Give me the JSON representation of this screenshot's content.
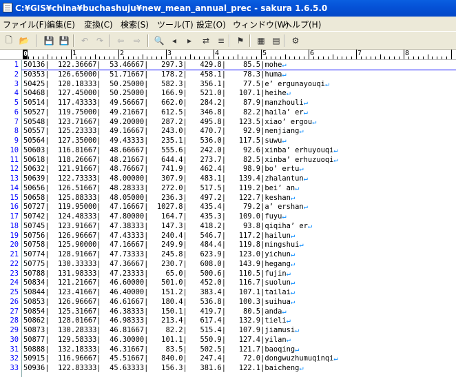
{
  "window": {
    "title": "C:¥GIS¥china¥buchashuju¥new_mean_annual_prec - sakura 1.6.5.0"
  },
  "menu": [
    "ファイル(F)",
    "編集(E)",
    "変換(C)",
    "検索(S)",
    "ツール(T)",
    "設定(O)",
    "ウィンドウ(W)",
    "ヘルプ(H)"
  ],
  "toolbar_icons": [
    "new-file-icon",
    "open-folder-icon",
    "save-disabled-icon",
    "save-icon",
    "undo-icon",
    "redo-icon",
    "jump-back-icon",
    "jump-forward-icon",
    "search-icon",
    "search-prev-icon",
    "search-next-icon",
    "replace-icon",
    "grep-icon",
    "bookmark-icon",
    "outline-icon",
    "fold-icon",
    "settings-icon"
  ],
  "ruler": {
    "marks": [
      "0",
      "1",
      "2",
      "3",
      "4",
      "5",
      "6",
      "7",
      "8"
    ]
  },
  "lines": [
    {
      "n": "1",
      "text": "50136|  122.36667|  53.46667|   297.3|   429.8|    85.5|mohe"
    },
    {
      "n": "2",
      "text": "50353|  126.65000|  51.71667|   178.2|   458.1|    78.3|huma"
    },
    {
      "n": "3",
      "text": "50425|  120.18333|  50.25000|   582.3|   356.1|    77.5|e’ ergunayouqi"
    },
    {
      "n": "4",
      "text": "50468|  127.45000|  50.25000|   166.9|   521.0|   107.1|heihe"
    },
    {
      "n": "5",
      "text": "50514|  117.43333|  49.56667|   662.0|   284.2|    87.9|manzhouli"
    },
    {
      "n": "6",
      "text": "50527|  119.75000|  49.21667|   612.5|   346.8|    82.2|haila’ er"
    },
    {
      "n": "7",
      "text": "50548|  123.71667|  49.20000|   287.2|   495.8|   123.5|xiao’ ergou"
    },
    {
      "n": "8",
      "text": "50557|  125.23333|  49.16667|   243.0|   470.7|    92.9|nenjiang"
    },
    {
      "n": "9",
      "text": "50564|  127.35000|  49.43333|   235.1|   536.0|   117.5|suwu"
    },
    {
      "n": "10",
      "text": "50603|  116.81667|  48.66667|   555.6|   242.0|    92.6|xinba’ erhuyouqi"
    },
    {
      "n": "11",
      "text": "50618|  118.26667|  48.21667|   644.4|   273.7|    82.5|xinba’ erhuzuoqi"
    },
    {
      "n": "12",
      "text": "50632|  121.91667|  48.76667|   741.9|   462.4|    98.9|bo’ ertu"
    },
    {
      "n": "13",
      "text": "50639|  122.73333|  48.00000|   307.9|   483.1|   139.4|zhalantun"
    },
    {
      "n": "14",
      "text": "50656|  126.51667|  48.28333|   272.0|   517.5|   119.2|bei’ an"
    },
    {
      "n": "15",
      "text": "50658|  125.88333|  48.05000|   236.3|   497.2|   122.7|keshan"
    },
    {
      "n": "16",
      "text": "50727|  119.95000|  47.16667|  1027.8|   435.4|    79.2|a’ ershan"
    },
    {
      "n": "17",
      "text": "50742|  124.48333|  47.80000|   164.7|   435.3|   109.0|fuyu"
    },
    {
      "n": "18",
      "text": "50745|  123.91667|  47.38333|   147.3|   418.2|    93.8|qiqiha’ er"
    },
    {
      "n": "19",
      "text": "50756|  126.96667|  47.43333|   240.4|   546.7|   117.2|hailun"
    },
    {
      "n": "20",
      "text": "50758|  125.90000|  47.16667|   249.9|   484.4|   119.8|mingshui"
    },
    {
      "n": "21",
      "text": "50774|  128.91667|  47.73333|   245.8|   623.9|   123.0|yichun"
    },
    {
      "n": "22",
      "text": "50775|  130.33333|  47.36667|   230.7|   608.0|   143.9|hegang"
    },
    {
      "n": "23",
      "text": "50788|  131.98333|  47.23333|    65.0|   500.6|   110.5|fujin"
    },
    {
      "n": "24",
      "text": "50834|  121.21667|  46.60000|   501.0|   452.0|   116.7|suolun"
    },
    {
      "n": "25",
      "text": "50844|  123.41667|  46.40000|   151.2|   383.4|   107.1|tailai"
    },
    {
      "n": "26",
      "text": "50853|  126.96667|  46.61667|   180.4|   536.8|   100.3|suihua"
    },
    {
      "n": "27",
      "text": "50854|  125.31667|  46.38333|   150.1|   419.7|    80.5|anda"
    },
    {
      "n": "28",
      "text": "50862|  128.01667|  46.98333|   213.4|   617.4|   132.9|tieli"
    },
    {
      "n": "29",
      "text": "50873|  130.28333|  46.81667|    82.2|   515.4|   107.9|jiamusi"
    },
    {
      "n": "30",
      "text": "50877|  129.58333|  46.30000|   101.1|   550.9|   127.4|yilan"
    },
    {
      "n": "31",
      "text": "50888|  132.18333|  46.31667|    83.5|   502.5|   121.7|baoqing"
    },
    {
      "n": "32",
      "text": "50915|  116.96667|  45.51667|   840.0|   247.4|    72.0|dongwuzhumuqinqi"
    },
    {
      "n": "33",
      "text": "50936|  122.83333|  45.63333|   156.3|   381.6|   122.1|baicheng"
    }
  ]
}
